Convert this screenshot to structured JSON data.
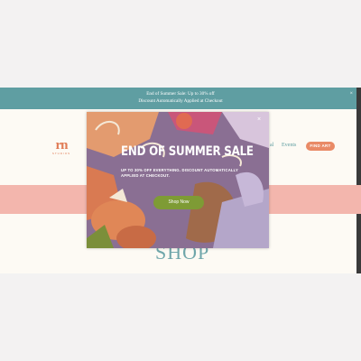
{
  "announcement": {
    "line1": "End of Summer Sale: Up to 30% off",
    "line2": "Discount Automatically Applied at Checkout",
    "close_glyph": "×"
  },
  "header": {
    "logo_mark": "rn",
    "logo_sub": "STUDIOS",
    "nav": [
      "al",
      "Events"
    ],
    "cta_label": "FIND ART"
  },
  "main": {
    "shop_heading": "SHOP"
  },
  "popup": {
    "close_glyph": "×",
    "headline": "END OF SUMMER SALE",
    "subline": "UP TO 30% OFF EVERYTHING. DISCOUNT AUTOMATICALLY APPLIED AT CHECKOUT.",
    "button_label": "Shop Now"
  },
  "colors": {
    "announcement_bg": "#5f9ea2",
    "accent": "#e98a66",
    "pink_band": "#f3b6ad",
    "button_green": "#7e9b35"
  }
}
